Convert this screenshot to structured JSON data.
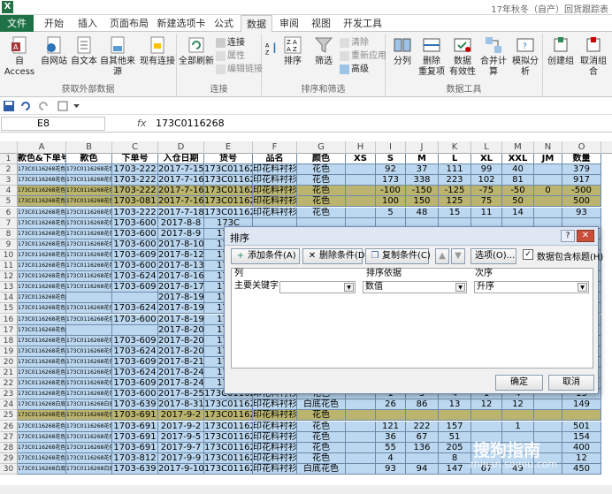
{
  "title_bar": {
    "app_icon": "X",
    "title": "17年秋冬（自产）回货跟踪表"
  },
  "tabs": [
    "文件",
    "开始",
    "插入",
    "页面布局",
    "新建选项卡",
    "公式",
    "数据",
    "审阅",
    "视图",
    "开发工具"
  ],
  "active_tab": "数据",
  "ribbon": {
    "groups": [
      {
        "label": "获取外部数据",
        "buttons": [
          "自 Access",
          "自网站",
          "自文本",
          "自其他来源",
          "现有连接"
        ]
      },
      {
        "label": "连接",
        "buttons": [
          "全部刷新"
        ],
        "small": [
          "连接",
          "属性",
          "编辑链接"
        ]
      },
      {
        "label": "排序和筛选",
        "buttons": [
          "排序",
          "筛选"
        ],
        "small": [
          "清除",
          "重新应用",
          "高级"
        ]
      },
      {
        "label": "数据工具",
        "buttons": [
          "分列",
          "删除\n重复项",
          "数据\n有效性",
          "合并计算",
          "模拟分析"
        ]
      },
      {
        "label": "",
        "buttons": [
          "创建组",
          "取消组合"
        ]
      }
    ]
  },
  "formula_bar": {
    "name_box": "E8",
    "fx": "fx",
    "value": "173C0116268"
  },
  "columns": [
    "A",
    "B",
    "C",
    "D",
    "E",
    "F",
    "G",
    "H",
    "I",
    "J",
    "K",
    "L",
    "M",
    "N",
    "O"
  ],
  "header_row": [
    "款色&下单号",
    "款色",
    "下单号",
    "入仓日期",
    "货号",
    "品名",
    "颜色",
    "XS",
    "S",
    "M",
    "L",
    "XL",
    "XXL",
    "JM",
    "数量"
  ],
  "rows": [
    {
      "n": "2",
      "cells": [
        "173C0116268花色1703-222",
        "173C0116268花色",
        "1703-222",
        "2017-7-15",
        "173C0116268",
        "印花料衬衫",
        "花色",
        "",
        "92",
        "37",
        "111",
        "99",
        "40",
        "",
        "379"
      ],
      "style": "b"
    },
    {
      "n": "3",
      "cells": [
        "173C0116268花色1703-222",
        "173C0116268花色",
        "1703-222",
        "2017-7-16",
        "173C0116268",
        "印花料衬衫",
        "花色",
        "",
        "173",
        "338",
        "223",
        "102",
        "81",
        "",
        "917"
      ],
      "style": "b"
    },
    {
      "n": "4",
      "cells": [
        "173C0116268花色1703-222",
        "173C0116268花色",
        "1703-222",
        "2017-7-16",
        "173C0116268",
        "印花料衬衫",
        "花色",
        "",
        "-100",
        "-150",
        "-125",
        "-75",
        "-50",
        "0",
        "-500"
      ],
      "style": "y"
    },
    {
      "n": "5",
      "cells": [
        "173C0116268花色1703-081",
        "173C0116268花色",
        "1703-081",
        "2017-7-16",
        "173C0116268",
        "印花料衬衫",
        "花色",
        "",
        "100",
        "150",
        "125",
        "75",
        "50",
        "",
        "500"
      ],
      "style": "y"
    },
    {
      "n": "6",
      "cells": [
        "173C0116268花色1703-222",
        "173C0116268花色",
        "1703-222",
        "2017-7-18",
        "173C0116268",
        "印花料衬衫",
        "花色",
        "",
        "5",
        "48",
        "15",
        "11",
        "14",
        "",
        "93"
      ],
      "style": "b"
    },
    {
      "n": "7",
      "cells": [
        "173C0116268花色1703-600",
        "173C0116268花色",
        "1703-600",
        "2017-8-8",
        "173C",
        "",
        "",
        "",
        "",
        "",
        "",
        "",
        "",
        "",
        ""
      ],
      "style": "b"
    },
    {
      "n": "8",
      "cells": [
        "173C0116268花色1703-600",
        "173C0116268花色",
        "1703-600",
        "2017-8-9",
        "173C",
        "",
        "",
        "",
        "",
        "",
        "",
        "",
        "",
        "",
        ""
      ],
      "style": "b"
    },
    {
      "n": "9",
      "cells": [
        "173C0116268花色1703-600",
        "173C0116268花色",
        "1703-600",
        "2017-8-10",
        "173C",
        "",
        "",
        "",
        "",
        "",
        "",
        "",
        "",
        "",
        ""
      ],
      "style": "b"
    },
    {
      "n": "10",
      "cells": [
        "173C0116268花色1703-609",
        "173C0116268花色",
        "1703-609",
        "2017-8-12",
        "173C",
        "",
        "",
        "",
        "",
        "",
        "",
        "",
        "",
        "",
        ""
      ],
      "style": "b"
    },
    {
      "n": "11",
      "cells": [
        "173C0116268花色1703-600",
        "173C0116268花色",
        "1703-600",
        "2017-8-13",
        "173C",
        "",
        "",
        "",
        "",
        "",
        "",
        "",
        "",
        "",
        ""
      ],
      "style": "b"
    },
    {
      "n": "12",
      "cells": [
        "173C0116268花色1703-624",
        "173C0116268花色",
        "1703-624",
        "2017-8-16",
        "173C",
        "",
        "",
        "",
        "",
        "",
        "",
        "",
        "",
        "",
        ""
      ],
      "style": "b"
    },
    {
      "n": "13",
      "cells": [
        "173C0116268花色1703-609",
        "173C0116268花色",
        "1703-609",
        "2017-8-17",
        "173C",
        "",
        "",
        "",
        "",
        "",
        "",
        "",
        "",
        "",
        ""
      ],
      "style": "b"
    },
    {
      "n": "14",
      "cells": [
        "173C0116268花色",
        "",
        "",
        "2017-8-19",
        "173C",
        "",
        "",
        "",
        "",
        "",
        "",
        "",
        "",
        "",
        ""
      ],
      "style": "b"
    },
    {
      "n": "15",
      "cells": [
        "173C0116268花色1703-624",
        "173C0116268花色",
        "1703-624",
        "2017-8-19",
        "173C",
        "",
        "",
        "",
        "",
        "",
        "",
        "",
        "",
        "",
        ""
      ],
      "style": "b"
    },
    {
      "n": "16",
      "cells": [
        "173C0116268花色1703-600",
        "173C0116268花色",
        "1703-600",
        "2017-8-19",
        "173C",
        "",
        "",
        "",
        "",
        "",
        "",
        "",
        "",
        "",
        ""
      ],
      "style": "b"
    },
    {
      "n": "17",
      "cells": [
        "173C0116268花色",
        "",
        "",
        "2017-8-20",
        "173C",
        "",
        "",
        "",
        "",
        "",
        "",
        "",
        "",
        "",
        ""
      ],
      "style": "b"
    },
    {
      "n": "18",
      "cells": [
        "173C0116268花色1703-609",
        "173C0116268花色",
        "1703-609",
        "2017-8-20",
        "173C",
        "",
        "",
        "",
        "",
        "",
        "",
        "",
        "",
        "",
        ""
      ],
      "style": "b"
    },
    {
      "n": "19",
      "cells": [
        "173C0116268花色1703-624",
        "173C0116268花色",
        "1703-624",
        "2017-8-20",
        "173C",
        "",
        "",
        "",
        "",
        "",
        "",
        "",
        "",
        "",
        ""
      ],
      "style": "b"
    },
    {
      "n": "20",
      "cells": [
        "173C0116268花色1703-609",
        "173C0116268花色",
        "1703-609",
        "2017-8-21",
        "173C",
        "",
        "",
        "",
        "",
        "",
        "",
        "",
        "",
        "",
        ""
      ],
      "style": "b"
    },
    {
      "n": "21",
      "cells": [
        "173C0116268花色1703-624",
        "173C0116268花色",
        "1703-624",
        "2017-8-24",
        "173C",
        "",
        "",
        "",
        "",
        "",
        "",
        "",
        "",
        "",
        ""
      ],
      "style": "b"
    },
    {
      "n": "22",
      "cells": [
        "173C0116268花色1703-609",
        "173C0116268花色",
        "1703-609",
        "2017-8-24",
        "173C",
        "",
        "",
        "",
        "",
        "",
        "",
        "",
        "",
        "",
        ""
      ],
      "style": "b"
    },
    {
      "n": "23",
      "cells": [
        "173C0116268花色1703-600",
        "173C0116268花色",
        "1703-600",
        "2017-8-25",
        "173C0116268",
        "印花料衬衫",
        "花色",
        "",
        "1",
        "3",
        "4",
        "1",
        "4",
        "",
        "13"
      ],
      "style": "b"
    },
    {
      "n": "24",
      "cells": [
        "173C0116268白底花色1703-639",
        "173C0116268白底花色",
        "1703-639",
        "2017-8-31",
        "173C0116268",
        "印花料衬衫",
        "白底花色",
        "",
        "26",
        "86",
        "13",
        "12",
        "12",
        "",
        "149"
      ],
      "style": "b"
    },
    {
      "n": "25",
      "cells": [
        "173C0116268花色1703-691",
        "173C0116268花色",
        "1703-691",
        "2017-9-2",
        "173C0116268",
        "印花料衬衫",
        "花色",
        "",
        "",
        "",
        "",
        "",
        "",
        "",
        ""
      ],
      "style": "y"
    },
    {
      "n": "26",
      "cells": [
        "173C0116268花色1703-691",
        "173C0116268花色",
        "1703-691",
        "2017-9-2",
        "173C0116268",
        "印花料衬衫",
        "花色",
        "",
        "121",
        "222",
        "157",
        "",
        "1",
        "",
        "501"
      ],
      "style": "b"
    },
    {
      "n": "27",
      "cells": [
        "173C0116268花色1703-691",
        "173C0116268花色",
        "1703-691",
        "2017-9-5",
        "173C0116268",
        "印花料衬衫",
        "花色",
        "",
        "36",
        "67",
        "51",
        "",
        "",
        "",
        "154"
      ],
      "style": "b"
    },
    {
      "n": "28",
      "cells": [
        "173C0116268花色1703-691",
        "173C0116268花色",
        "1703-691",
        "2017-9-7",
        "173C0116268",
        "印花料衬衫",
        "花色",
        "",
        "55",
        "136",
        "205",
        "",
        "",
        "",
        "400"
      ],
      "style": "b"
    },
    {
      "n": "29",
      "cells": [
        "173C0116268花色1703-812",
        "173C0116268花色",
        "1703-812",
        "2017-9-9",
        "173C0116268",
        "印花料衬衫",
        "花色",
        "",
        "4",
        "",
        "8",
        "",
        "",
        "",
        "12"
      ],
      "style": "b"
    },
    {
      "n": "30",
      "cells": [
        "173C0116268白底花色1703-639",
        "173C0116268白底花色",
        "1703-639",
        "2017-9-10",
        "173C0116268",
        "印花料衬衫",
        "白底花色",
        "",
        "93",
        "94",
        "147",
        "67",
        "49",
        "",
        "450"
      ],
      "style": "b"
    }
  ],
  "sort_dialog": {
    "title": "排序",
    "help": "?",
    "close": "✕",
    "buttons": {
      "add": "添加条件(A)",
      "delete": "删除条件(D)",
      "copy": "复制条件(C)",
      "up": "▲",
      "down": "▼",
      "options": "选项(O)...",
      "ok": "确定",
      "cancel": "取消"
    },
    "checkbox_label": "数据包含标题(H)",
    "checkbox_checked": true,
    "col_header": "列",
    "basis_header": "排序依据",
    "order_header": "次序",
    "row_label": "主要关键字",
    "key_value": "",
    "basis_value": "数值",
    "order_value": "升序"
  },
  "watermark": {
    "text": "搜狗指南",
    "url": "zhinan.sogou.com"
  }
}
